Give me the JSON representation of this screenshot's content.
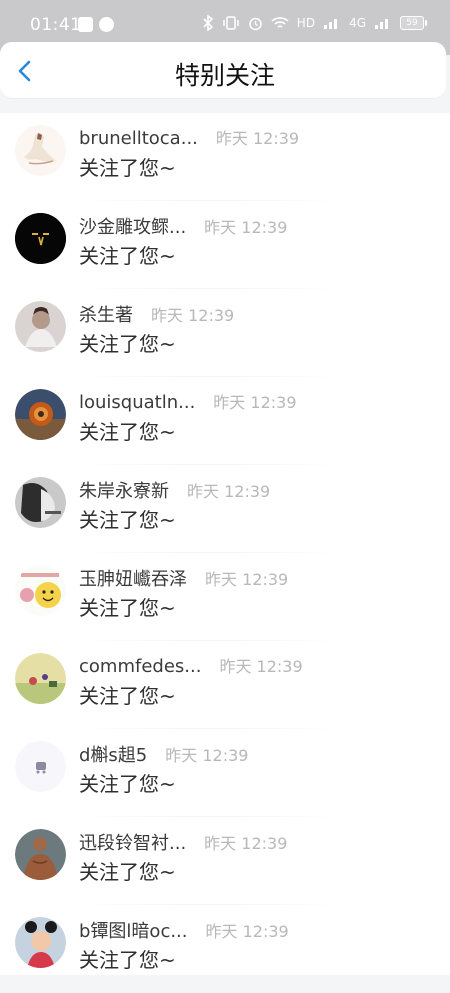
{
  "status_bar": {
    "time": "01:41",
    "network_label": "HD",
    "signal1_label": "4G",
    "battery": "59"
  },
  "header": {
    "title": "特别关注",
    "back_icon": "chevron-left-icon",
    "accent_color": "#2d87d8"
  },
  "items": [
    {
      "name": "brunelltoca...",
      "time": "昨天 12:39",
      "message": "关注了您~"
    },
    {
      "name": "沙金雕攻鳏...",
      "time": "昨天 12:39",
      "message": "关注了您~"
    },
    {
      "name": "杀生著",
      "time": "昨天 12:39",
      "message": "关注了您~"
    },
    {
      "name": "louisquatln...",
      "time": "昨天 12:39",
      "message": "关注了您~"
    },
    {
      "name": "朱岸永寮新",
      "time": "昨天 12:39",
      "message": "关注了您~"
    },
    {
      "name": "玉胂妞巇吞泽",
      "time": "昨天 12:39",
      "message": "关注了您~"
    },
    {
      "name": "commfedes...",
      "time": "昨天 12:39",
      "message": "关注了您~"
    },
    {
      "name": "d槲s趄5",
      "time": "昨天 12:39",
      "message": "关注了您~"
    },
    {
      "name": "迅段铃智衬...",
      "time": "昨天 12:39",
      "message": "关注了您~"
    },
    {
      "name": "b镡图l暗oc...",
      "time": "昨天 12:39",
      "message": "关注了您~"
    }
  ]
}
